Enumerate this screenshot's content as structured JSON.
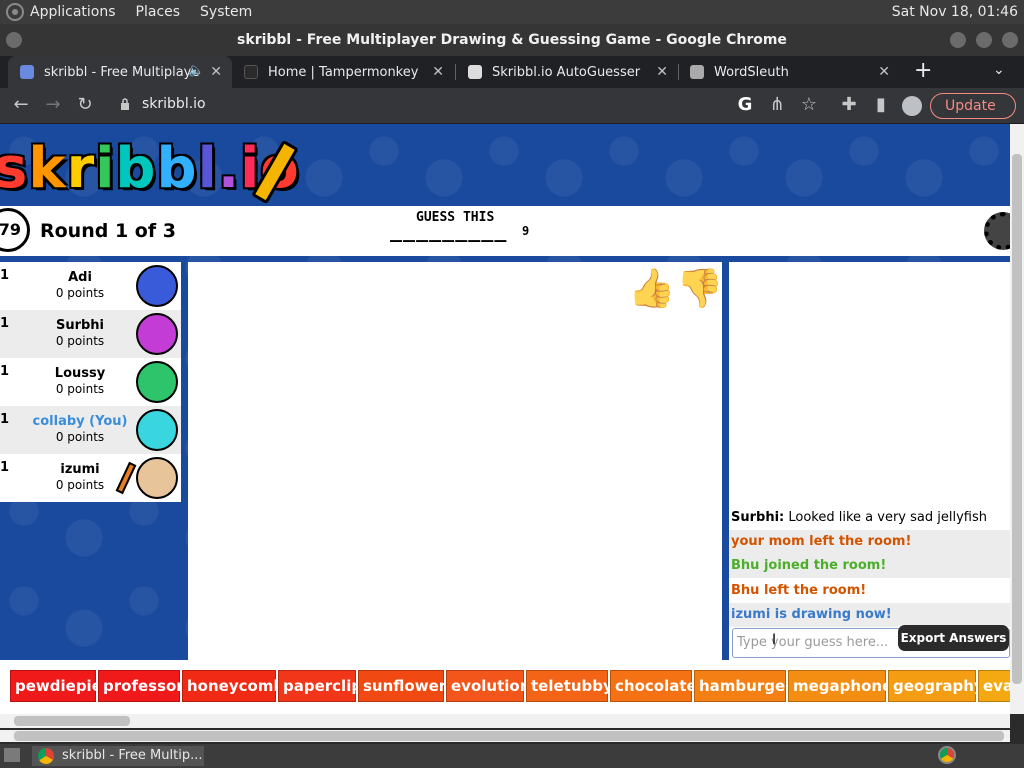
{
  "os": {
    "menus": [
      "Applications",
      "Places",
      "System"
    ],
    "clock": "Sat Nov 18, 01:46"
  },
  "window": {
    "title": "skribbl - Free Multiplayer Drawing & Guessing Game - Google Chrome"
  },
  "browser": {
    "tabs": [
      {
        "label": "skribbl - Free Multiplaye",
        "active": true,
        "icon": "skribbl-favicon",
        "audio": true
      },
      {
        "label": "Home | Tampermonkey",
        "active": false,
        "icon": "tampermonkey-favicon"
      },
      {
        "label": "Skribbl.io AutoGuesser",
        "active": false,
        "icon": "greasyfork-favicon"
      },
      {
        "label": "WordSleuth",
        "active": false,
        "icon": "github-favicon"
      }
    ],
    "url": "skribbl.io",
    "update_label": "Update"
  },
  "game": {
    "logo_text": "skribbl.io",
    "timer": "79",
    "round_text": "Round 1 of 3",
    "guess_label": "GUESS THIS",
    "word_blanks": "_________",
    "word_length": "9",
    "players": [
      {
        "rank": "1",
        "name": "Adi",
        "points": "0 points",
        "color": "#3a5bd9",
        "you": false
      },
      {
        "rank": "1",
        "name": "Surbhi",
        "points": "0 points",
        "color": "#c43cd6",
        "you": false
      },
      {
        "rank": "1",
        "name": "Loussy",
        "points": "0 points",
        "color": "#2ec46b",
        "you": false
      },
      {
        "rank": "1",
        "name": "collaby (You)",
        "points": "0 points",
        "color": "#3ad6e0",
        "you": true
      },
      {
        "rank": "1",
        "name": "izumi",
        "points": "0 points",
        "color": "#e8c49a",
        "you": false,
        "drawing": true
      }
    ],
    "chat": [
      {
        "sender": "Surbhi:",
        "text": " Looked like a very sad jellyfish",
        "color": "#000000"
      },
      {
        "sender": "",
        "text": "your mom left the room!",
        "color": "#d35400"
      },
      {
        "sender": "",
        "text": "Bhu joined the room!",
        "color": "#4caf2a"
      },
      {
        "sender": "",
        "text": "Bhu left the room!",
        "color": "#d35400"
      },
      {
        "sender": "",
        "text": "izumi is drawing now!",
        "color": "#3b7ac9"
      }
    ],
    "chat_placeholder": "Type your guess here...",
    "export_label": "Export Answers",
    "words": [
      {
        "text": "pewdiepie",
        "color": "#f01a1a"
      },
      {
        "text": "professor",
        "color": "#f01a1a"
      },
      {
        "text": "honeycomb",
        "color": "#f02a14"
      },
      {
        "text": "paperclip",
        "color": "#f2361a"
      },
      {
        "text": "sunflower",
        "color": "#f04a12"
      },
      {
        "text": "evolution",
        "color": "#f2561a"
      },
      {
        "text": "teletubby",
        "color": "#f46416"
      },
      {
        "text": "chocolate",
        "color": "#f47214"
      },
      {
        "text": "hamburger",
        "color": "#f48014"
      },
      {
        "text": "megaphone",
        "color": "#f48e12"
      },
      {
        "text": "geography",
        "color": "#f49c12"
      },
      {
        "text": "eva",
        "color": "#f4a812"
      }
    ]
  },
  "taskbar": {
    "task_label": "skribbl - Free Multip..."
  }
}
